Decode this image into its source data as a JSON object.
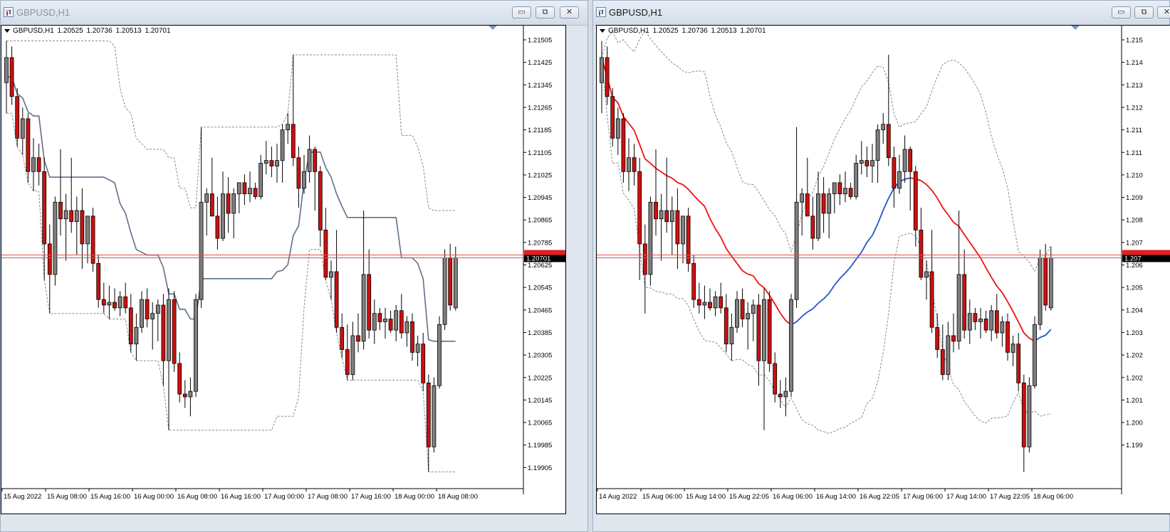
{
  "windows": [
    {
      "id": "left",
      "title": "GBPUSD,H1",
      "active": false,
      "info_symbol": "GBPUSD,H1",
      "ohlc": [
        "1.20525",
        "1.20736",
        "1.20513",
        "1.20701"
      ],
      "price_labels": [
        "1.21505",
        "1.21425",
        "1.21345",
        "1.21265",
        "1.21185",
        "1.21105",
        "1.21025",
        "1.20945",
        "1.20865",
        "1.20785",
        "1.20625",
        "1.20545",
        "1.20465",
        "1.20385",
        "1.20305",
        "1.20225",
        "1.20145",
        "1.20065",
        "1.19985",
        "1.19905"
      ],
      "current_price": "1.20701",
      "time_labels": [
        "15 Aug 2022",
        "15 Aug 08:00",
        "15 Aug 16:00",
        "16 Aug 00:00",
        "16 Aug 08:00",
        "16 Aug 16:00",
        "17 Aug 00:00",
        "17 Aug 08:00",
        "17 Aug 16:00",
        "18 Aug 00:00",
        "18 Aug 08:00"
      ],
      "indicator": "donchian"
    },
    {
      "id": "right",
      "title": "GBPUSD,H1",
      "active": true,
      "info_symbol": "GBPUSD,H1",
      "ohlc": [
        "1.20525",
        "1.20736",
        "1.20513",
        "1.20701"
      ],
      "price_labels": [
        "1.215",
        "1.214",
        "1.213",
        "1.212",
        "1.211",
        "1.211",
        "1.210",
        "1.209",
        "1.208",
        "1.207",
        "1.206",
        "1.205",
        "1.204",
        "1.203",
        "1.202",
        "1.202",
        "1.201",
        "1.200",
        "1.199"
      ],
      "current_price": "1.207",
      "time_labels": [
        "14 Aug 2022",
        "15 Aug 06:00",
        "15 Aug 14:00",
        "15 Aug 22:05",
        "16 Aug 06:00",
        "16 Aug 14:00",
        "16 Aug 22:05",
        "17 Aug 06:00",
        "17 Aug 14:00",
        "17 Aug 22:05",
        "18 Aug 06:00"
      ],
      "indicator": "bollinger"
    }
  ],
  "window_buttons": {
    "minimize": "▭",
    "restore": "⧉",
    "close": "✕"
  },
  "colors": {
    "bull_candle": "#808080",
    "bear_candle": "#cc1010",
    "donchian_line": "#5e7187",
    "ma_down": "#ee1111",
    "ma_up": "#2255cc",
    "band": "#8a8a8a",
    "price_line": "#e05050",
    "price_tag": "#000000"
  },
  "chart_data": {
    "type": "candlestick",
    "symbol": "GBPUSD",
    "timeframe": "H1",
    "candles": [
      {
        "o": 1.2133,
        "h": 1.2148,
        "l": 1.2122,
        "c": 1.2142
      },
      {
        "o": 1.2142,
        "h": 1.2146,
        "l": 1.2125,
        "c": 1.2128
      },
      {
        "o": 1.2128,
        "h": 1.2131,
        "l": 1.211,
        "c": 1.2113
      },
      {
        "o": 1.2113,
        "h": 1.2124,
        "l": 1.2107,
        "c": 1.212
      },
      {
        "o": 1.212,
        "h": 1.2122,
        "l": 1.2097,
        "c": 1.2101
      },
      {
        "o": 1.2101,
        "h": 1.2113,
        "l": 1.2094,
        "c": 1.2106
      },
      {
        "o": 1.2106,
        "h": 1.2111,
        "l": 1.2096,
        "c": 1.2101
      },
      {
        "o": 1.2101,
        "h": 1.2106,
        "l": 1.2062,
        "c": 1.2075
      },
      {
        "o": 1.2075,
        "h": 1.2082,
        "l": 1.205,
        "c": 1.2064
      },
      {
        "o": 1.2064,
        "h": 1.2092,
        "l": 1.206,
        "c": 1.209
      },
      {
        "o": 1.209,
        "h": 1.2109,
        "l": 1.2078,
        "c": 1.2084
      },
      {
        "o": 1.2084,
        "h": 1.2093,
        "l": 1.2069,
        "c": 1.2087
      },
      {
        "o": 1.2087,
        "h": 1.2106,
        "l": 1.2079,
        "c": 1.2083
      },
      {
        "o": 1.2083,
        "h": 1.2092,
        "l": 1.2071,
        "c": 1.2087
      },
      {
        "o": 1.2087,
        "h": 1.2095,
        "l": 1.2066,
        "c": 1.2075
      },
      {
        "o": 1.2075,
        "h": 1.2084,
        "l": 1.2068,
        "c": 1.2085
      },
      {
        "o": 1.2085,
        "h": 1.2088,
        "l": 1.2065,
        "c": 1.2068
      },
      {
        "o": 1.2068,
        "h": 1.2071,
        "l": 1.2052,
        "c": 1.2055
      },
      {
        "o": 1.2055,
        "h": 1.2061,
        "l": 1.205,
        "c": 1.2053
      },
      {
        "o": 1.2053,
        "h": 1.206,
        "l": 1.2048,
        "c": 1.2054
      },
      {
        "o": 1.2054,
        "h": 1.2059,
        "l": 1.2051,
        "c": 1.2052
      },
      {
        "o": 1.2052,
        "h": 1.2058,
        "l": 1.2049,
        "c": 1.2056
      },
      {
        "o": 1.2056,
        "h": 1.2061,
        "l": 1.205,
        "c": 1.2052
      },
      {
        "o": 1.2052,
        "h": 1.2057,
        "l": 1.2036,
        "c": 1.2039
      },
      {
        "o": 1.2039,
        "h": 1.205,
        "l": 1.2033,
        "c": 1.2045
      },
      {
        "o": 1.2045,
        "h": 1.2058,
        "l": 1.2043,
        "c": 1.2055
      },
      {
        "o": 1.2055,
        "h": 1.2059,
        "l": 1.2045,
        "c": 1.2048
      },
      {
        "o": 1.2048,
        "h": 1.2054,
        "l": 1.2037,
        "c": 1.205
      },
      {
        "o": 1.205,
        "h": 1.2055,
        "l": 1.204,
        "c": 1.2053
      },
      {
        "o": 1.2053,
        "h": 1.2057,
        "l": 1.2024,
        "c": 1.2033
      },
      {
        "o": 1.2033,
        "h": 1.2059,
        "l": 1.2008,
        "c": 1.2055
      },
      {
        "o": 1.2055,
        "h": 1.2058,
        "l": 1.2029,
        "c": 1.2032
      },
      {
        "o": 1.2032,
        "h": 1.2036,
        "l": 1.2018,
        "c": 1.2021
      },
      {
        "o": 1.2021,
        "h": 1.2026,
        "l": 1.2016,
        "c": 1.202
      },
      {
        "o": 1.202,
        "h": 1.2027,
        "l": 1.2013,
        "c": 1.2022
      },
      {
        "o": 1.2022,
        "h": 1.2057,
        "l": 1.202,
        "c": 1.2055
      },
      {
        "o": 1.2055,
        "h": 1.2117,
        "l": 1.2052,
        "c": 1.209
      },
      {
        "o": 1.209,
        "h": 1.2095,
        "l": 1.2078,
        "c": 1.2093
      },
      {
        "o": 1.2093,
        "h": 1.2106,
        "l": 1.2085,
        "c": 1.2085
      },
      {
        "o": 1.2085,
        "h": 1.2092,
        "l": 1.2073,
        "c": 1.2077
      },
      {
        "o": 1.2077,
        "h": 1.2101,
        "l": 1.2076,
        "c": 1.2093
      },
      {
        "o": 1.2093,
        "h": 1.2099,
        "l": 1.2079,
        "c": 1.2086
      },
      {
        "o": 1.2086,
        "h": 1.2095,
        "l": 1.2077,
        "c": 1.2093
      },
      {
        "o": 1.2093,
        "h": 1.2097,
        "l": 1.2086,
        "c": 1.2097
      },
      {
        "o": 1.2097,
        "h": 1.21,
        "l": 1.2089,
        "c": 1.2093
      },
      {
        "o": 1.2093,
        "h": 1.2101,
        "l": 1.209,
        "c": 1.2095
      },
      {
        "o": 1.2095,
        "h": 1.2097,
        "l": 1.2091,
        "c": 1.2092
      },
      {
        "o": 1.2092,
        "h": 1.2107,
        "l": 1.2091,
        "c": 1.2104
      },
      {
        "o": 1.2104,
        "h": 1.2112,
        "l": 1.21,
        "c": 1.2105
      },
      {
        "o": 1.2105,
        "h": 1.211,
        "l": 1.2099,
        "c": 1.2103
      },
      {
        "o": 1.2103,
        "h": 1.2111,
        "l": 1.2097,
        "c": 1.2105
      },
      {
        "o": 1.2105,
        "h": 1.2118,
        "l": 1.2097,
        "c": 1.2116
      },
      {
        "o": 1.2116,
        "h": 1.2122,
        "l": 1.2111,
        "c": 1.2118
      },
      {
        "o": 1.2118,
        "h": 1.2143,
        "l": 1.2103,
        "c": 1.2106
      },
      {
        "o": 1.2106,
        "h": 1.211,
        "l": 1.2088,
        "c": 1.2095
      },
      {
        "o": 1.2095,
        "h": 1.2107,
        "l": 1.2093,
        "c": 1.2101
      },
      {
        "o": 1.2101,
        "h": 1.2114,
        "l": 1.2097,
        "c": 1.2109
      },
      {
        "o": 1.2109,
        "h": 1.211,
        "l": 1.2087,
        "c": 1.2101
      },
      {
        "o": 1.2101,
        "h": 1.2103,
        "l": 1.2074,
        "c": 1.208
      },
      {
        "o": 1.208,
        "h": 1.2088,
        "l": 1.2062,
        "c": 1.2063
      },
      {
        "o": 1.2063,
        "h": 1.2069,
        "l": 1.2055,
        "c": 1.2065
      },
      {
        "o": 1.2065,
        "h": 1.208,
        "l": 1.2043,
        "c": 1.2045
      },
      {
        "o": 1.2045,
        "h": 1.205,
        "l": 1.2034,
        "c": 1.2037
      },
      {
        "o": 1.2037,
        "h": 1.2046,
        "l": 1.2026,
        "c": 1.2028
      },
      {
        "o": 1.2028,
        "h": 1.2047,
        "l": 1.2026,
        "c": 1.2042
      },
      {
        "o": 1.2042,
        "h": 1.205,
        "l": 1.2036,
        "c": 1.204
      },
      {
        "o": 1.204,
        "h": 1.2087,
        "l": 1.2037,
        "c": 1.2064
      },
      {
        "o": 1.2064,
        "h": 1.2073,
        "l": 1.2041,
        "c": 1.2044
      },
      {
        "o": 1.2044,
        "h": 1.2055,
        "l": 1.2039,
        "c": 1.205
      },
      {
        "o": 1.205,
        "h": 1.2052,
        "l": 1.2044,
        "c": 1.2047
      },
      {
        "o": 1.2047,
        "h": 1.2052,
        "l": 1.2041,
        "c": 1.2048
      },
      {
        "o": 1.2048,
        "h": 1.2051,
        "l": 1.2043,
        "c": 1.2044
      },
      {
        "o": 1.2044,
        "h": 1.2053,
        "l": 1.204,
        "c": 1.2051
      },
      {
        "o": 1.2051,
        "h": 1.2057,
        "l": 1.2041,
        "c": 1.2043
      },
      {
        "o": 1.2043,
        "h": 1.2049,
        "l": 1.2038,
        "c": 1.2047
      },
      {
        "o": 1.2047,
        "h": 1.205,
        "l": 1.2033,
        "c": 1.2036
      },
      {
        "o": 1.2036,
        "h": 1.2042,
        "l": 1.2031,
        "c": 1.2039
      },
      {
        "o": 1.2039,
        "h": 1.2043,
        "l": 1.2022,
        "c": 1.2025
      },
      {
        "o": 1.2025,
        "h": 1.2028,
        "l": 1.1993,
        "c": 1.2002
      },
      {
        "o": 1.2002,
        "h": 1.2027,
        "l": 1.2,
        "c": 1.2024
      },
      {
        "o": 1.2024,
        "h": 1.2049,
        "l": 1.2023,
        "c": 1.2046
      },
      {
        "o": 1.2046,
        "h": 1.2073,
        "l": 1.2044,
        "c": 1.207
      },
      {
        "o": 1.207,
        "h": 1.2075,
        "l": 1.2051,
        "c": 1.2053
      },
      {
        "o": 1.2052,
        "h": 1.2074,
        "l": 1.2051,
        "c": 1.207
      }
    ]
  }
}
